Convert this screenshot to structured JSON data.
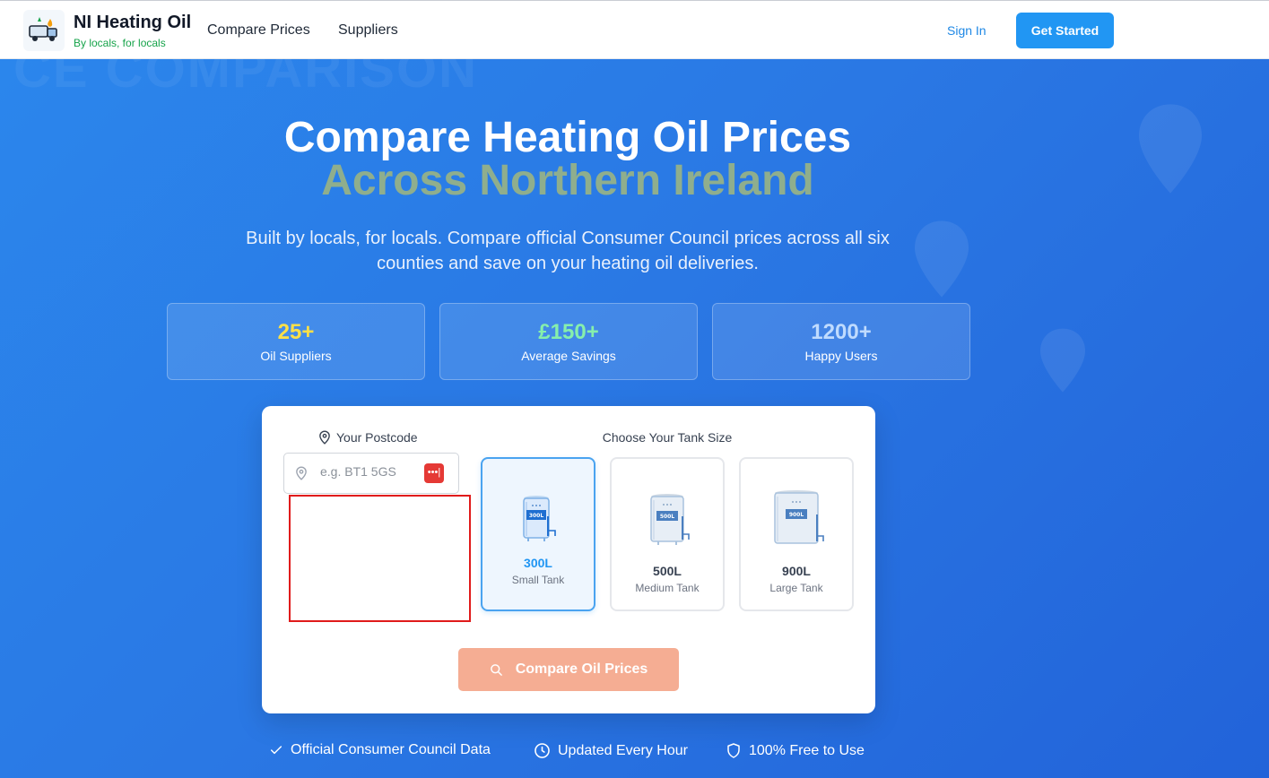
{
  "header": {
    "brand_title": "NI Heating Oil",
    "brand_subtitle": "By locals, for locals",
    "nav": [
      "Compare Prices",
      "Suppliers"
    ],
    "sign_in": "Sign In",
    "get_started": "Get Started"
  },
  "hero": {
    "background_word": "CE COMPARISON",
    "title_line1": "Compare Heating Oil Prices",
    "title_line2": "Across Northern Ireland",
    "subtitle": "Built by locals, for locals. Compare official Consumer Council prices across all six counties and save on your heating oil deliveries.",
    "stats": [
      {
        "value": "25+",
        "label": "Oil Suppliers",
        "color": "#fde047"
      },
      {
        "value": "£150+",
        "label": "Average Savings",
        "color": "#86efac"
      },
      {
        "value": "1200+",
        "label": "Happy Users",
        "color": "#bfdbfe"
      }
    ]
  },
  "search": {
    "postcode_label": "Your Postcode",
    "postcode_placeholder": "e.g. BT1 5GS",
    "postcode_value": "",
    "password_icon_text": "•••|",
    "tank_heading": "Choose Your Tank Size",
    "tanks": [
      {
        "size": "300L",
        "name": "Small Tank",
        "badge": "300L",
        "selected": true
      },
      {
        "size": "500L",
        "name": "Medium Tank",
        "badge": "500L",
        "selected": false
      },
      {
        "size": "900L",
        "name": "Large Tank",
        "badge": "900L",
        "selected": false
      }
    ],
    "compare_button": "Compare Oil Prices"
  },
  "features": [
    {
      "icon": "check-icon",
      "label": "Official Consumer Council Data"
    },
    {
      "icon": "clock-icon",
      "label": "Updated Every Hour"
    },
    {
      "icon": "shield-icon",
      "label": "100% Free to Use"
    }
  ],
  "colors": {
    "brand_blue": "#2196f3",
    "hero_blue": "#2a78e4",
    "title_green": "#8fae8d",
    "tagline_green": "#16a34a",
    "compare_button": "#f5ad93"
  }
}
